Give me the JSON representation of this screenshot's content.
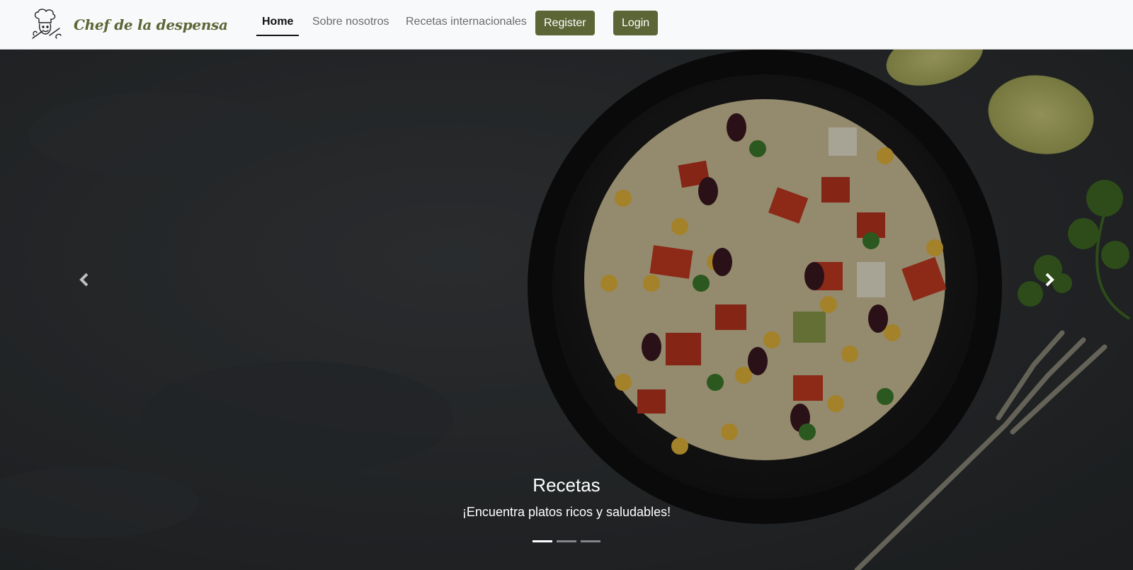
{
  "brand": {
    "name": "Chef de la despensa",
    "logo_icon": "chef-logo-icon"
  },
  "nav": {
    "home": "Home",
    "about": "Sobre nosotros",
    "international": "Recetas internacionales",
    "register": "Register",
    "login": "Login"
  },
  "colors": {
    "accent": "#5b6535",
    "navbar_bg": "#f8f9fa"
  },
  "carousel": {
    "title": "Recetas",
    "text": "¡Encuentra platos ricos y saludables!",
    "prev_icon": "chevron-left-icon",
    "next_icon": "chevron-right-icon",
    "slides": 3,
    "active_slide": 1
  }
}
